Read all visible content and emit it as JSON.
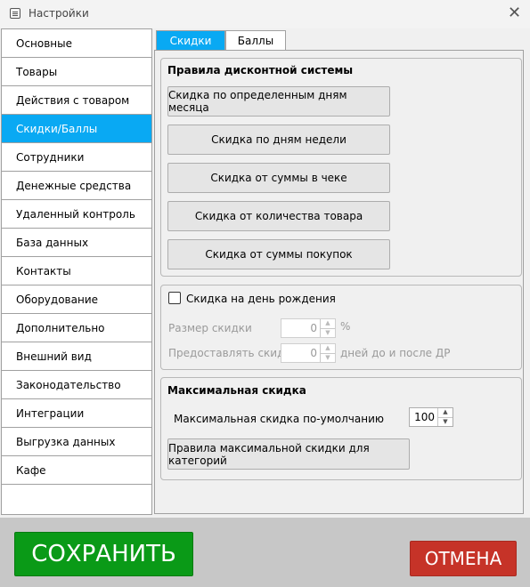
{
  "window": {
    "title": "Настройки"
  },
  "sidebar": {
    "items": [
      {
        "label": "Основные"
      },
      {
        "label": "Товары"
      },
      {
        "label": "Действия с товаром"
      },
      {
        "label": "Скидки/Баллы"
      },
      {
        "label": "Сотрудники"
      },
      {
        "label": "Денежные средства"
      },
      {
        "label": "Удаленный контроль"
      },
      {
        "label": "База данных"
      },
      {
        "label": "Контакты"
      },
      {
        "label": "Оборудование"
      },
      {
        "label": "Дополнительно"
      },
      {
        "label": "Внешний вид"
      },
      {
        "label": "Законодательство"
      },
      {
        "label": "Интеграции"
      },
      {
        "label": "Выгрузка данных"
      },
      {
        "label": "Кафе"
      }
    ],
    "active": "Скидки/Баллы"
  },
  "tabs": [
    {
      "label": "Скидки"
    },
    {
      "label": "Баллы"
    }
  ],
  "discount_rules": {
    "title": "Правила дисконтной системы",
    "buttons": [
      "Скидка по определенным дням месяца",
      "Скидка по дням недели",
      "Скидка от суммы в чеке",
      "Скидка от количества товара",
      "Скидка от суммы покупок"
    ]
  },
  "birthday": {
    "checkbox_label": "Скидка на день рождения",
    "checked": false,
    "size_label": "Размер скидки",
    "size_value": "0",
    "size_unit": "%",
    "provide_label": "Предоставлять скидку",
    "provide_value": "0",
    "provide_unit": "дней до и после ДР"
  },
  "max_discount": {
    "title": "Максимальная скидка",
    "default_label": "Максимальная скидка по-умолчанию",
    "default_value": "100",
    "category_rules_button": "Правила максимальной скидки для категорий"
  },
  "footer": {
    "save_label": "СОХРАНИТЬ",
    "cancel_label": "ОТМЕНА",
    "save_color": "#0a9a17",
    "cancel_color": "#c63328"
  },
  "accent_color": "#09a9f3"
}
